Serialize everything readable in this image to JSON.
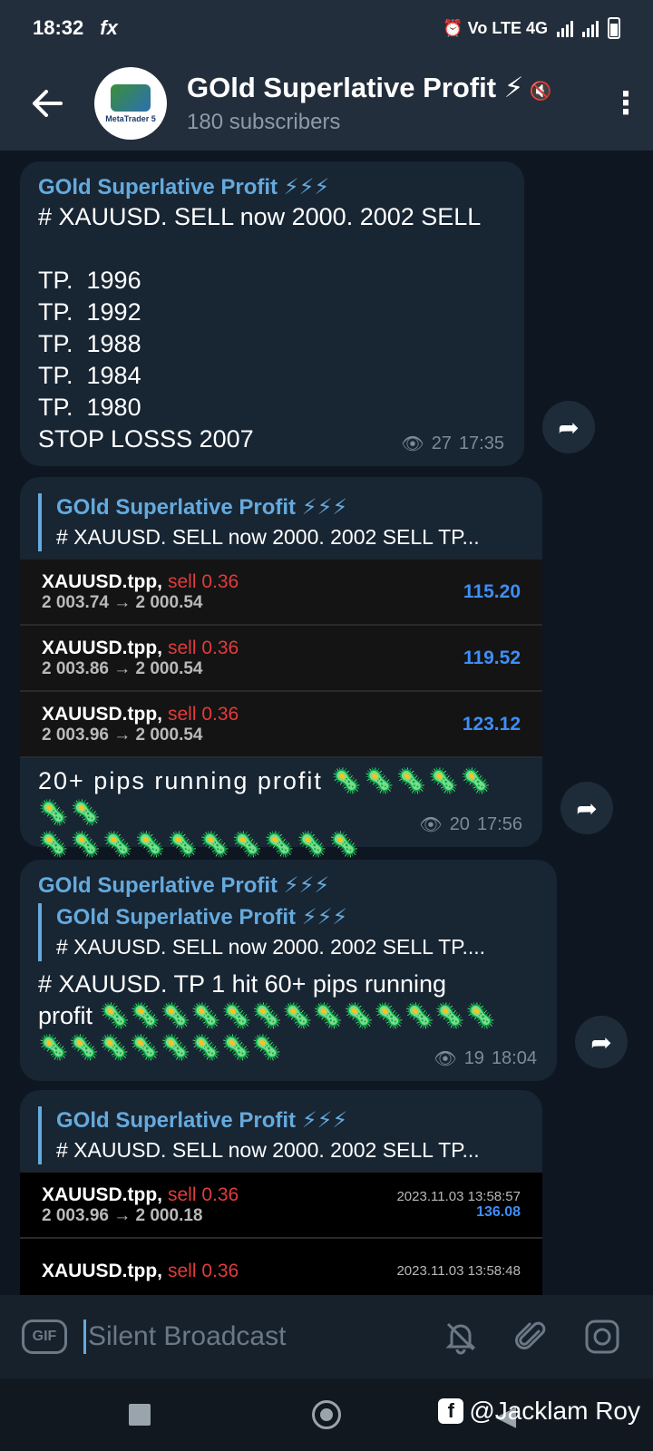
{
  "status": {
    "time": "18:32",
    "app_icon": "fx",
    "indicators": "⏰ Vo LTE 4G"
  },
  "header": {
    "back_icon": "back-arrow-icon",
    "avatar_text": "MetaTrader 5",
    "title": "GOld Superlative Profit ⚡",
    "subtitle": "180 subscribers",
    "menu_icon": "more-vert-icon"
  },
  "messages": [
    {
      "sender": "GOld Superlative Profit ⚡⚡⚡",
      "text": "# XAUUSD. SELL now 2000. 2002 SELL\n\nTP.  1996\nTP.  1992\nTP.  1988\nTP.  1984\nTP.  1980\nSTOP LOSSS 2007",
      "views": "27",
      "time": "17:35"
    },
    {
      "reply_title": "GOld Superlative Profit ⚡⚡⚡",
      "reply_text": "# XAUUSD. SELL now 2000. 2002 SELL  TP...",
      "trades": [
        {
          "symbol": "XAUUSD.tpp,",
          "side": "sell 0.36",
          "prices": "2 003.74 → 2 000.54",
          "profit": "115.20"
        },
        {
          "symbol": "XAUUSD.tpp,",
          "side": "sell 0.36",
          "prices": "2 003.86 → 2 000.54",
          "profit": "119.52"
        },
        {
          "symbol": "XAUUSD.tpp,",
          "side": "sell 0.36",
          "prices": "2 003.96 → 2 000.54",
          "profit": "123.12"
        }
      ],
      "text": "20+ pips running profit 🦠🦠🦠🦠🦠🦠🦠\n🦠🦠🦠🦠🦠🦠🦠🦠🦠🦠",
      "views": "20",
      "time": "17:56"
    },
    {
      "sender": "GOld Superlative Profit ⚡⚡⚡",
      "reply_title": "GOld Superlative Profit ⚡⚡⚡",
      "reply_text": "# XAUUSD. SELL now 2000. 2002 SELL  TP....",
      "text": "# XAUUSD. TP 1 hit 60+ pips running\nprofit 🦠🦠🦠🦠🦠🦠🦠🦠🦠🦠🦠🦠🦠\n🦠🦠🦠🦠🦠🦠🦠🦠",
      "views": "19",
      "time": "18:04"
    },
    {
      "reply_title": "GOld Superlative Profit ⚡⚡⚡",
      "reply_text": "# XAUUSD. SELL now 2000. 2002 SELL  TP...",
      "trades": [
        {
          "symbol": "XAUUSD.tpp,",
          "side": "sell 0.36",
          "prices": "2 003.96 → 2 000.18",
          "date": "2023.11.03 13:58:57",
          "profit": "136.08"
        },
        {
          "symbol": "XAUUSD.tpp,",
          "side": "sell 0.36",
          "prices": "",
          "date": "2023.11.03 13:58:48",
          "profit": ""
        }
      ]
    }
  ],
  "input": {
    "gif_label": "GIF",
    "placeholder": "Silent Broadcast"
  },
  "watermark": "@Jacklam Roy"
}
